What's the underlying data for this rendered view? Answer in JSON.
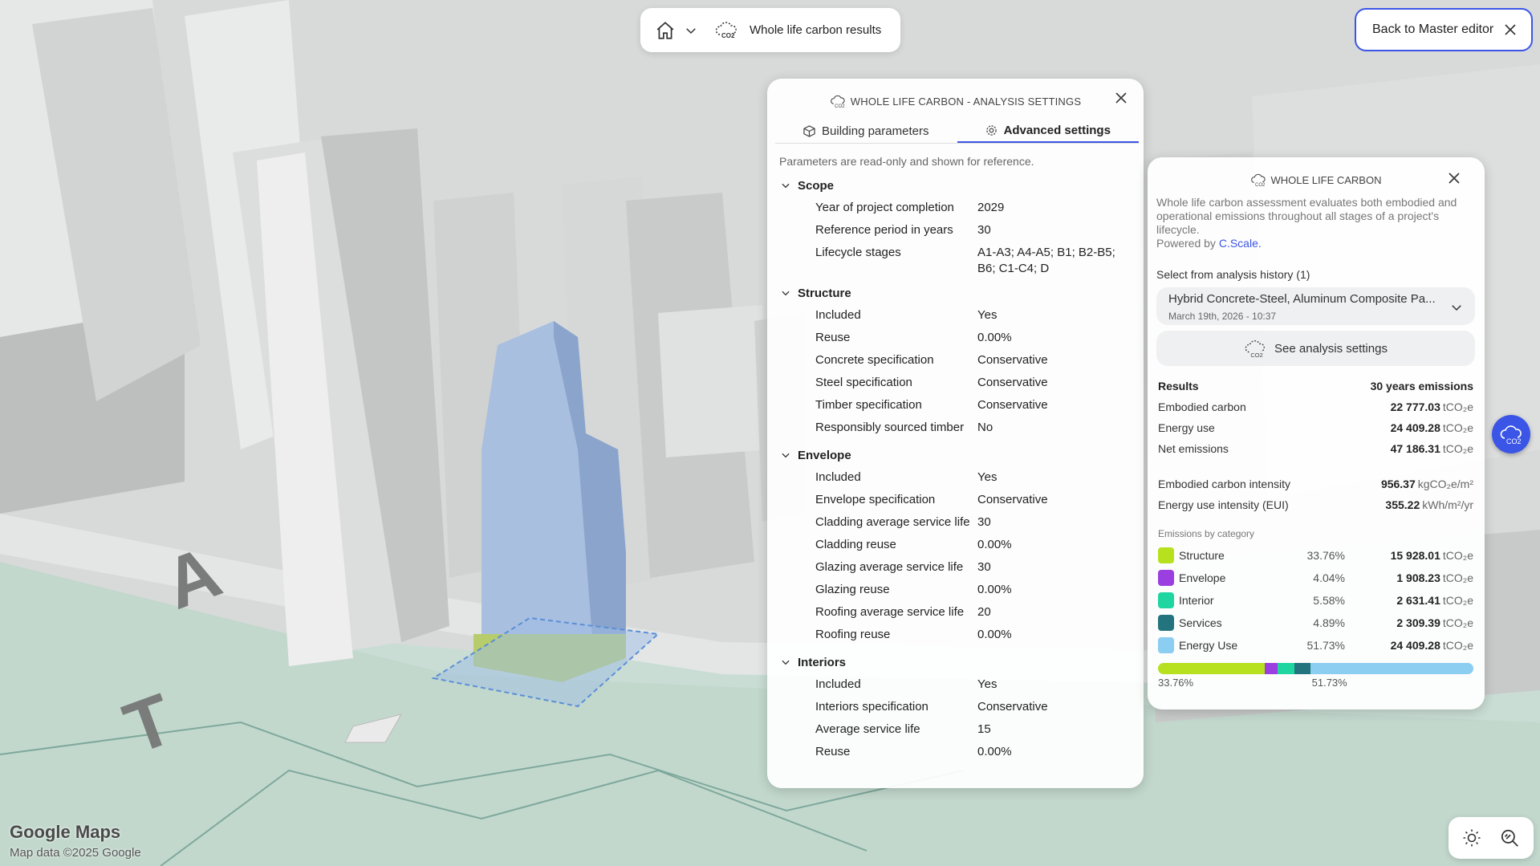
{
  "topbar": {
    "title": "Whole life carbon results",
    "home_icon": "home-icon",
    "co2_icon": "co2-cloud-icon"
  },
  "back_button": {
    "label": "Back to Master editor"
  },
  "settings_panel": {
    "title": "WHOLE LIFE CARBON - ANALYSIS SETTINGS",
    "tabs": [
      {
        "label": "Building parameters",
        "active": false
      },
      {
        "label": "Advanced settings",
        "active": true
      }
    ],
    "note": "Parameters are read-only and shown for reference.",
    "sections": [
      {
        "title": "Scope",
        "rows": [
          {
            "k": "Year of project completion",
            "v": "2029"
          },
          {
            "k": "Reference period in years",
            "v": "30"
          },
          {
            "k": "Lifecycle stages",
            "v": "A1-A3; A4-A5; B1; B2-B5; B6; C1-C4; D"
          }
        ]
      },
      {
        "title": "Structure",
        "rows": [
          {
            "k": "Included",
            "v": "Yes"
          },
          {
            "k": "Reuse",
            "v": "0.00%"
          },
          {
            "k": "Concrete specification",
            "v": "Conservative"
          },
          {
            "k": "Steel specification",
            "v": "Conservative"
          },
          {
            "k": "Timber specification",
            "v": "Conservative"
          },
          {
            "k": "Responsibly sourced timber",
            "v": "No"
          }
        ]
      },
      {
        "title": "Envelope",
        "rows": [
          {
            "k": "Included",
            "v": "Yes"
          },
          {
            "k": "Envelope specification",
            "v": "Conservative"
          },
          {
            "k": "Cladding average service life",
            "v": "30"
          },
          {
            "k": "Cladding reuse",
            "v": "0.00%"
          },
          {
            "k": "Glazing average service life",
            "v": "30"
          },
          {
            "k": "Glazing reuse",
            "v": "0.00%"
          },
          {
            "k": "Roofing average service life",
            "v": "20"
          },
          {
            "k": "Roofing reuse",
            "v": "0.00%"
          }
        ]
      },
      {
        "title": "Interiors",
        "rows": [
          {
            "k": "Included",
            "v": "Yes"
          },
          {
            "k": "Interiors specification",
            "v": "Conservative"
          },
          {
            "k": "Average service life",
            "v": "15"
          },
          {
            "k": "Reuse",
            "v": "0.00%"
          }
        ]
      }
    ]
  },
  "results_panel": {
    "title": "WHOLE LIFE CARBON",
    "description": "Whole life carbon assessment evaluates both embodied and operational emissions throughout all stages of a project's lifecycle.",
    "powered_by": "Powered by",
    "powered_link": "C.Scale.",
    "history_label": "Select from analysis history (1)",
    "history_selected": "Hybrid Concrete-Steel, Aluminum Composite Pa...",
    "history_date": "March 19th, 2026 - 10:37",
    "see_settings_label": "See analysis settings",
    "results_header": "Results",
    "results_header_right": "30 years emissions",
    "results": [
      {
        "label": "Embodied carbon",
        "value": "22 777.03",
        "unit": "tCO₂e"
      },
      {
        "label": "Energy use",
        "value": "24 409.28",
        "unit": "tCO₂e"
      },
      {
        "label": "Net emissions",
        "value": "47 186.31",
        "unit": "tCO₂e"
      }
    ],
    "intensities": [
      {
        "label": "Embodied carbon intensity",
        "value": "956.37",
        "unit": "kgCO₂e/m²"
      },
      {
        "label": "Energy use intensity (EUI)",
        "value": "355.22",
        "unit": "kWh/m²/yr"
      }
    ],
    "categories_header": "Emissions by category",
    "categories": [
      {
        "name": "Structure",
        "pct": "33.76%",
        "value": "15 928.01",
        "unit": "tCO₂e",
        "color": "#b7e01e",
        "share": 33.76
      },
      {
        "name": "Envelope",
        "pct": "4.04%",
        "value": "1 908.23",
        "unit": "tCO₂e",
        "color": "#9b3fe0",
        "share": 4.04
      },
      {
        "name": "Interior",
        "pct": "5.58%",
        "value": "2 631.41",
        "unit": "tCO₂e",
        "color": "#1fd6a0",
        "share": 5.58
      },
      {
        "name": "Services",
        "pct": "4.89%",
        "value": "2 309.39",
        "unit": "tCO₂e",
        "color": "#23747f",
        "share": 4.89
      },
      {
        "name": "Energy Use",
        "pct": "51.73%",
        "value": "24 409.28",
        "unit": "tCO₂e",
        "color": "#8ccdf2",
        "share": 51.73
      }
    ],
    "bar_label_left": "33.76%",
    "bar_label_right": "51.73%"
  },
  "map": {
    "logo": "Google Maps",
    "copyright": "Map data ©2025 Google"
  }
}
